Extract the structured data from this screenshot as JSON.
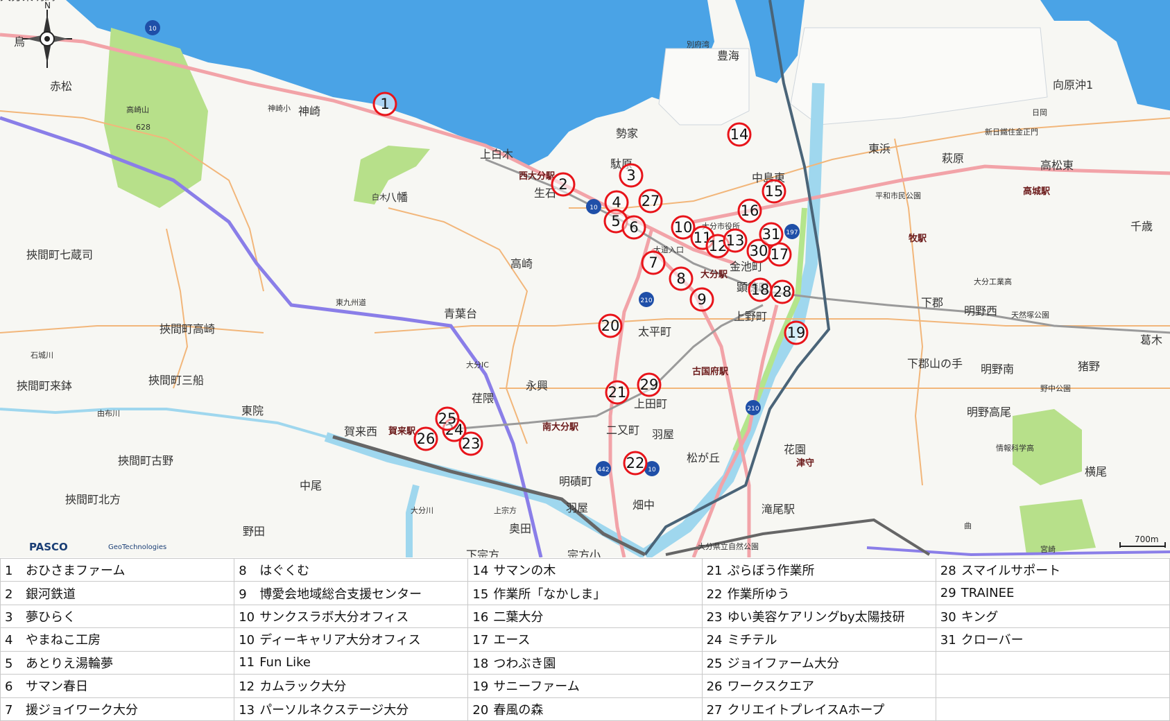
{
  "map": {
    "compass_label": "N",
    "scale_label": "700m",
    "credits": [
      "PASCO",
      "GeoTechnologies"
    ],
    "place_names": [
      "鳥",
      "赤松",
      "神崎",
      "神崎小",
      "高崎山",
      "628",
      "白木",
      "八幡",
      "上白木",
      "生石",
      "西大分駅",
      "別府湾",
      "豊海",
      "勢家",
      "駄原",
      "中島東",
      "東浜",
      "萩原",
      "高松東",
      "向原沖1",
      "日岡",
      "新日鐵住金正門",
      "平和市民公園",
      "高城駅",
      "牧駅",
      "千歳",
      "大分工業高",
      "下郡",
      "明野西",
      "天然塚公園",
      "葛木",
      "下郡山の手",
      "明野南",
      "猪野",
      "明野高尾",
      "野中公園",
      "横尾",
      "大分駅",
      "大分市役所",
      "金池町",
      "顕徳町",
      "大道入口",
      "上野町",
      "高崎",
      "青葉台",
      "東九州道",
      "太平町",
      "古国府駅",
      "上田町",
      "羽屋",
      "二又町",
      "南大分駅",
      "永興",
      "荏隈",
      "東院",
      "賀来西",
      "賀来駅",
      "挾間町七蔵司",
      "挾間町高崎",
      "挾間町来鉢",
      "挾間町三船",
      "挾間町古野",
      "挾間町北方",
      "石城川",
      "由布川",
      "大分IC",
      "中尾",
      "野田",
      "大分川",
      "明磧町",
      "畑中",
      "羽屋",
      "奥田",
      "上宗方",
      "宗方小",
      "下宗方",
      "松が丘",
      "花園",
      "津守",
      "滝尾駅",
      "曲",
      "情報科学高",
      "大分県立自然公園",
      "宮崎",
      "大分東明高"
    ],
    "route_shields": [
      "10",
      "10",
      "197",
      "210",
      "210",
      "10",
      "442"
    ]
  },
  "markers": [
    "1",
    "2",
    "3",
    "4",
    "5",
    "6",
    "7",
    "8",
    "9",
    "10",
    "11",
    "12",
    "13",
    "14",
    "15",
    "16",
    "17",
    "18",
    "19",
    "20",
    "21",
    "22",
    "23",
    "24",
    "25",
    "26",
    "27",
    "28",
    "29",
    "30",
    "31"
  ],
  "legend": {
    "rows": [
      [
        {
          "num": "1",
          "name": "おひさまファーム"
        },
        {
          "num": "8",
          "name": "はぐくむ"
        },
        {
          "num": "14",
          "name": "サマンの木"
        },
        {
          "num": "21",
          "name": "ぷらぼう作業所"
        },
        {
          "num": "28",
          "name": "スマイルサポート"
        }
      ],
      [
        {
          "num": "2",
          "name": "銀河鉄道"
        },
        {
          "num": "9",
          "name": "博愛会地域総合支援センター"
        },
        {
          "num": "15",
          "name": "作業所「なかしま」"
        },
        {
          "num": "22",
          "name": "作業所ゆう"
        },
        {
          "num": "29",
          "name": "TRAINEE"
        }
      ],
      [
        {
          "num": "3",
          "name": "夢ひらく"
        },
        {
          "num": "10",
          "name": "サンクスラボ大分オフィス"
        },
        {
          "num": "16",
          "name": "二葉大分"
        },
        {
          "num": "23",
          "name": "ゆい美容ケアリングby太陽技研"
        },
        {
          "num": "30",
          "name": "キング"
        }
      ],
      [
        {
          "num": "4",
          "name": "やまねこ工房"
        },
        {
          "num": "10",
          "name": "ディーキャリア大分オフィス"
        },
        {
          "num": "17",
          "name": "エース"
        },
        {
          "num": "24",
          "name": "ミチテル"
        },
        {
          "num": "31",
          "name": "クローバー"
        }
      ],
      [
        {
          "num": "5",
          "name": "あとりえ湯輪夢"
        },
        {
          "num": "11",
          "name": "Fun Like"
        },
        {
          "num": "18",
          "name": "つわぶき園"
        },
        {
          "num": "25",
          "name": "ジョイファーム大分"
        },
        {
          "num": "",
          "name": ""
        }
      ],
      [
        {
          "num": "6",
          "name": "サマン春日"
        },
        {
          "num": "12",
          "name": "カムラック大分"
        },
        {
          "num": "19",
          "name": "サニーファーム"
        },
        {
          "num": "26",
          "name": "ワークスクエア"
        },
        {
          "num": "",
          "name": ""
        }
      ],
      [
        {
          "num": "7",
          "name": "援ジョイワーク大分"
        },
        {
          "num": "13",
          "name": "パーソルネクステージ大分"
        },
        {
          "num": "20",
          "name": "春風の森"
        },
        {
          "num": "27",
          "name": "クリエイトプレイスAホープ"
        },
        {
          "num": "",
          "name": ""
        }
      ]
    ]
  }
}
